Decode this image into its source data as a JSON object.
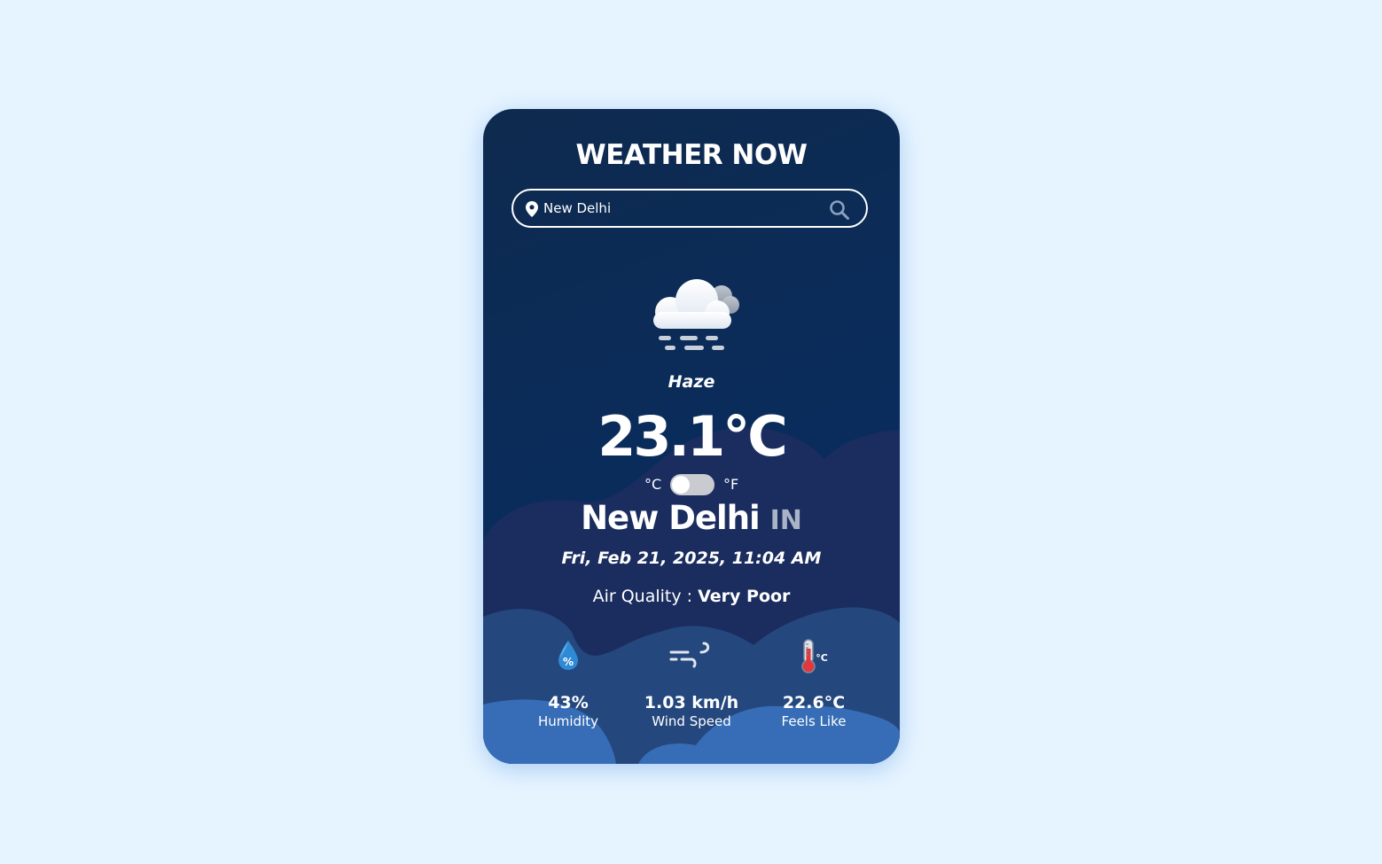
{
  "app": {
    "title": "WEATHER NOW"
  },
  "search": {
    "value": "New Delhi",
    "placeholder": "",
    "location_icon": "map-pin-icon",
    "search_icon": "search-icon"
  },
  "weather": {
    "icon": "haze-cloud-icon",
    "condition": "Haze",
    "temperature": "23.1°C",
    "unit_celsius": "°C",
    "unit_fahrenheit": "°F",
    "unit_toggle_is_fahrenheit": false,
    "city": "New Delhi",
    "country": "IN",
    "datetime": "Fri, Feb 21, 2025, 11:04 AM",
    "air_quality_label": "Air Quality :",
    "air_quality_value": "Very Poor"
  },
  "stats": [
    {
      "icon": "humidity-drop-icon",
      "value": "43%",
      "label": "Humidity"
    },
    {
      "icon": "wind-icon",
      "value": "1.03 km/h",
      "label": "Wind Speed"
    },
    {
      "icon": "thermometer-icon",
      "value": "22.6°C",
      "label": "Feels Like"
    }
  ],
  "colors": {
    "page_background": "#e6f4ff",
    "card_top": "#0e2a4e",
    "card_bottom": "#0b3163",
    "cloud_layer_1": "#1a2d5e",
    "cloud_layer_2": "#24477e",
    "cloud_layer_3": "#366db6",
    "toggle_track": "#c9cbd1"
  }
}
